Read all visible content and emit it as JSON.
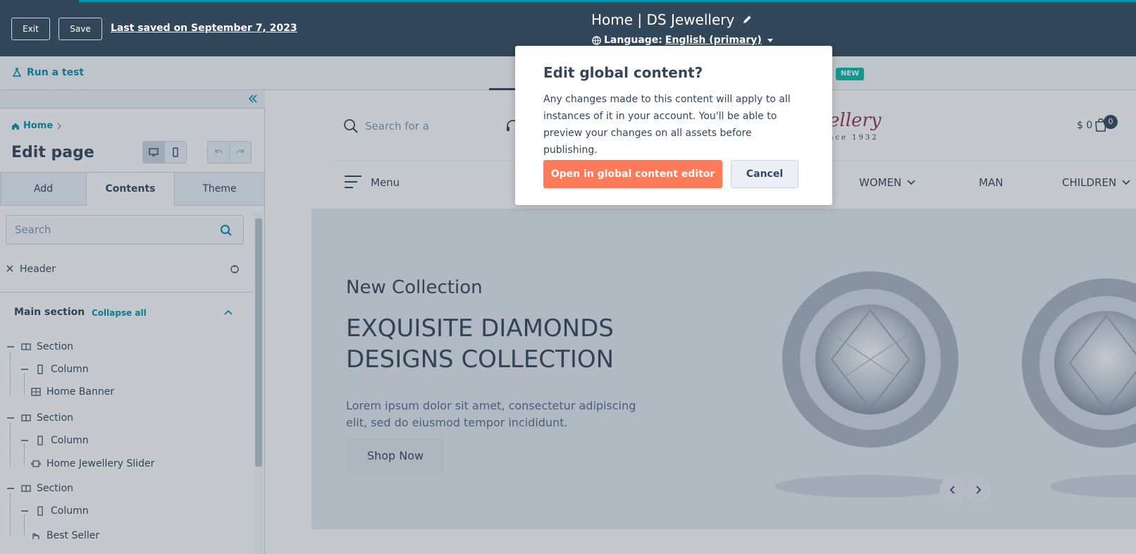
{
  "topbar": {
    "exit_label": "Exit",
    "save_label": "Save",
    "last_saved": "Last saved on September 7, 2023",
    "page_title": "Home | DS Jewellery",
    "language_prefix": "Language:",
    "language_value": "English (primary)"
  },
  "subbar": {
    "run_test_label": "Run a test",
    "new_badge": "NEW"
  },
  "sidebar": {
    "breadcrumb_home": "Home",
    "edit_title": "Edit page",
    "tabs": [
      "Add",
      "Contents",
      "Theme"
    ],
    "search_placeholder": "Search",
    "header_label": "Header",
    "main_section_label": "Main section",
    "collapse_all_label": "Collapse all",
    "tree": [
      {
        "label": "Section"
      },
      {
        "label": "Column"
      },
      {
        "label": "Home Banner"
      },
      {
        "label": "Section"
      },
      {
        "label": "Column"
      },
      {
        "label": "Home Jewellery Slider"
      },
      {
        "label": "Section"
      },
      {
        "label": "Column"
      },
      {
        "label": "Best Seller"
      }
    ]
  },
  "preview": {
    "search_placeholder": "Search for a",
    "logo_text": "ellery",
    "logo_since": "nce 1932",
    "cart_price": "$ 0",
    "cart_count": "0",
    "menu_label": "Menu",
    "nav_items": [
      "WOMEN",
      "MAN",
      "CHILDREN"
    ],
    "hero_kicker": "New Collection",
    "hero_title": "EXQUISITE DIAMONDS DESIGNS COLLECTION",
    "hero_body": "Lorem ipsum dolor sit amet, consectetur adipiscing elit, sed do eiusmod tempor incididunt.",
    "shop_label": "Shop Now"
  },
  "modal": {
    "title": "Edit global content?",
    "body": "Any changes made to this content will apply to all instances of it in your account. You'll be able to preview your changes on all assets before publishing.",
    "primary_label": "Open in global content editor",
    "cancel_label": "Cancel"
  },
  "colors": {
    "topbar": "#33475b",
    "accent": "#0091ae",
    "primary_button": "#ff7a59",
    "new_badge": "#00bda5"
  }
}
